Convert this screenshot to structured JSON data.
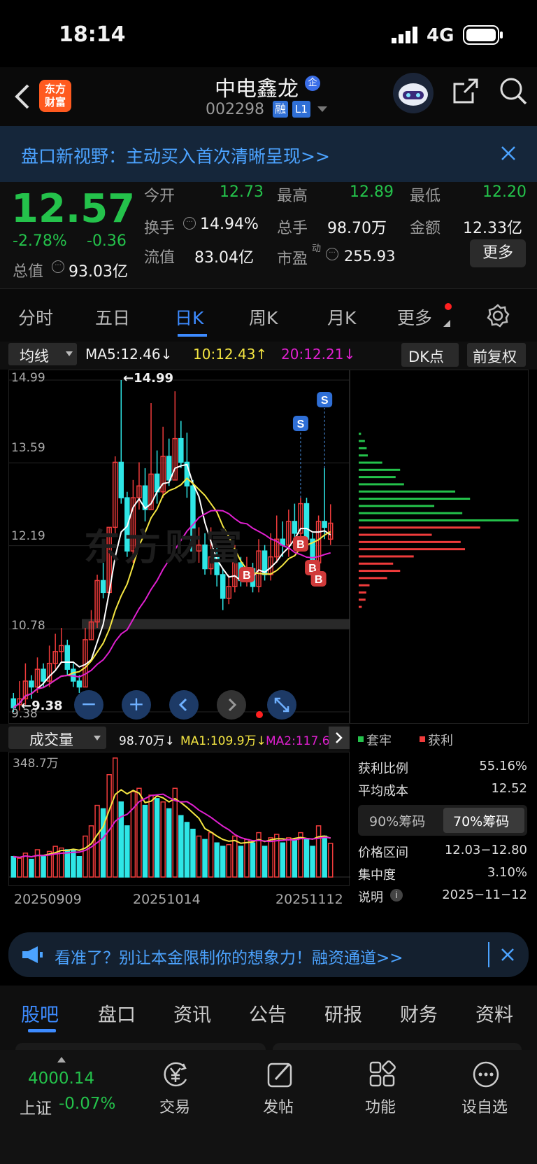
{
  "status_bar": {
    "time": "18:14",
    "network": "4G"
  },
  "header": {
    "broker_logo": "东方\n财富",
    "stock_name": "中电鑫龙",
    "badge": "企",
    "stock_code": "002298",
    "tag1": "融",
    "tag2": "L1"
  },
  "promo_top": {
    "text": "盘口新视野：主动买入首次清晰呈现>>"
  },
  "quote": {
    "price": "12.57",
    "change_pct": "-2.78%",
    "change_amt": "-0.36",
    "total_cap_label": "总值",
    "total_cap": "93.03亿",
    "open_label": "今开",
    "open": "12.73",
    "high_label": "最高",
    "high": "12.89",
    "low_label": "最低",
    "low": "12.20",
    "turnover_label": "换手",
    "turnover": "14.94%",
    "volume_label": "总手",
    "volume": "98.70万",
    "amount_label": "金额",
    "amount": "12.33亿",
    "float_label": "流值",
    "float_cap": "83.04亿",
    "pe_label": "市盈",
    "pe_sup": "动",
    "pe": "255.93",
    "more_button": "更多"
  },
  "period_tabs": [
    "分时",
    "五日",
    "日K",
    "周K",
    "月K",
    "更多"
  ],
  "active_tab": 2,
  "ma_bar": {
    "selector": "均线",
    "ma5": "MA5:12.46↓",
    "ma10": "10:12.43↑",
    "ma20": "20:12.21↓",
    "dk": "DK点",
    "adjust": "前复权"
  },
  "price_axis": [
    "14.99",
    "13.59",
    "12.19",
    "10.78",
    "9.38"
  ],
  "max_annotation": "←14.99",
  "min_annotation": "←9.38",
  "watermark": "东方财富",
  "vol_bar": {
    "selector": "成交量",
    "vol": "98.70万↓",
    "ma1": "MA1:109.9万↓",
    "ma2": "MA2:117.6万"
  },
  "vol_axis_max": "348.7万",
  "date_axis": [
    "20250909",
    "20251014",
    "20251112"
  ],
  "chips": {
    "legend_trapped": "套牢",
    "legend_profit": "获利",
    "profit_ratio_label": "获利比例",
    "profit_ratio": "55.16%",
    "avg_cost_label": "平均成本",
    "avg_cost": "12.52",
    "tab90": "90%筹码",
    "tab70": "70%筹码",
    "range_label": "价格区间",
    "range": "12.03−12.80",
    "concentration_label": "集中度",
    "concentration": "3.10%",
    "note_label": "说明",
    "date": "2025−11−12"
  },
  "promo_bottom": {
    "text": "看准了？别让本金限制你的想象力！融资通道>>"
  },
  "content_tabs": [
    "股吧",
    "盘口",
    "资讯",
    "公告",
    "研报",
    "财务",
    "资料"
  ],
  "bottom_nav": {
    "index_value": "4000.14",
    "index_name": "上证",
    "index_change": "-0.07%",
    "items": [
      "交易",
      "发帖",
      "功能",
      "设自选"
    ]
  },
  "colors": {
    "up": "#ef3b3b",
    "down": "#2ee6e6",
    "ma5": "#ffffff",
    "ma10": "#f5e642",
    "ma20": "#e020d0",
    "price_down": "#24c24b"
  },
  "chart_data": {
    "type": "candlestick",
    "title": "",
    "x_range": [
      "20250909",
      "20251112"
    ],
    "ylim": [
      9.38,
      14.99
    ],
    "candles": [
      {
        "o": 9.6,
        "c": 9.45,
        "h": 9.7,
        "l": 9.38
      },
      {
        "o": 9.5,
        "c": 9.6,
        "h": 9.9,
        "l": 9.4
      },
      {
        "o": 9.6,
        "c": 9.9,
        "h": 10.2,
        "l": 9.5
      },
      {
        "o": 9.9,
        "c": 9.8,
        "h": 10.0,
        "l": 9.6
      },
      {
        "o": 9.8,
        "c": 10.1,
        "h": 10.3,
        "l": 9.7
      },
      {
        "o": 10.1,
        "c": 9.9,
        "h": 10.2,
        "l": 9.8
      },
      {
        "o": 9.9,
        "c": 10.2,
        "h": 10.5,
        "l": 9.8
      },
      {
        "o": 10.2,
        "c": 10.4,
        "h": 10.7,
        "l": 10.1
      },
      {
        "o": 10.4,
        "c": 10.5,
        "h": 10.8,
        "l": 10.2
      },
      {
        "o": 10.5,
        "c": 10.1,
        "h": 10.6,
        "l": 10.0
      },
      {
        "o": 10.1,
        "c": 9.9,
        "h": 10.2,
        "l": 9.8
      },
      {
        "o": 9.9,
        "c": 9.8,
        "h": 10.0,
        "l": 9.7
      },
      {
        "o": 9.8,
        "c": 10.6,
        "h": 10.8,
        "l": 9.8
      },
      {
        "o": 10.6,
        "c": 10.9,
        "h": 11.1,
        "l": 10.6
      },
      {
        "o": 10.9,
        "c": 11.6,
        "h": 11.7,
        "l": 10.8
      },
      {
        "o": 11.6,
        "c": 11.4,
        "h": 11.9,
        "l": 11.3
      },
      {
        "o": 11.4,
        "c": 12.5,
        "h": 12.5,
        "l": 11.4
      },
      {
        "o": 12.5,
        "c": 13.6,
        "h": 13.7,
        "l": 12.4
      },
      {
        "o": 13.6,
        "c": 13.0,
        "h": 14.99,
        "l": 12.9
      },
      {
        "o": 13.0,
        "c": 12.1,
        "h": 13.1,
        "l": 12.0
      },
      {
        "o": 12.1,
        "c": 13.0,
        "h": 13.3,
        "l": 11.9
      },
      {
        "o": 13.0,
        "c": 13.2,
        "h": 13.6,
        "l": 12.8
      },
      {
        "o": 13.2,
        "c": 12.8,
        "h": 13.5,
        "l": 12.6
      },
      {
        "o": 12.8,
        "c": 13.4,
        "h": 14.6,
        "l": 12.8
      },
      {
        "o": 13.4,
        "c": 13.1,
        "h": 13.8,
        "l": 12.9
      },
      {
        "o": 13.1,
        "c": 13.7,
        "h": 14.2,
        "l": 13.0
      },
      {
        "o": 13.7,
        "c": 13.3,
        "h": 14.0,
        "l": 13.2
      },
      {
        "o": 13.3,
        "c": 14.0,
        "h": 14.8,
        "l": 13.3
      },
      {
        "o": 14.0,
        "c": 13.6,
        "h": 14.3,
        "l": 13.5
      },
      {
        "o": 13.6,
        "c": 13.2,
        "h": 14.1,
        "l": 13.0
      },
      {
        "o": 13.2,
        "c": 12.1,
        "h": 13.3,
        "l": 12.0
      },
      {
        "o": 12.1,
        "c": 12.2,
        "h": 12.5,
        "l": 11.9
      },
      {
        "o": 12.2,
        "c": 11.8,
        "h": 12.4,
        "l": 11.7
      },
      {
        "o": 11.8,
        "c": 12.0,
        "h": 12.5,
        "l": 11.7
      },
      {
        "o": 12.0,
        "c": 11.7,
        "h": 12.2,
        "l": 11.5
      },
      {
        "o": 11.7,
        "c": 11.3,
        "h": 11.8,
        "l": 11.1
      },
      {
        "o": 11.3,
        "c": 11.5,
        "h": 11.7,
        "l": 11.2
      },
      {
        "o": 11.5,
        "c": 11.9,
        "h": 12.2,
        "l": 11.4
      },
      {
        "o": 11.9,
        "c": 11.6,
        "h": 12.0,
        "l": 11.5
      },
      {
        "o": 11.6,
        "c": 11.8,
        "h": 12.0,
        "l": 11.5
      },
      {
        "o": 11.8,
        "c": 11.5,
        "h": 11.9,
        "l": 11.4
      },
      {
        "o": 11.5,
        "c": 12.1,
        "h": 12.3,
        "l": 11.4
      },
      {
        "o": 12.1,
        "c": 11.7,
        "h": 12.2,
        "l": 11.6
      },
      {
        "o": 11.7,
        "c": 12.0,
        "h": 12.4,
        "l": 11.6
      },
      {
        "o": 12.0,
        "c": 12.3,
        "h": 12.7,
        "l": 11.9
      },
      {
        "o": 12.3,
        "c": 12.2,
        "h": 12.6,
        "l": 12.0
      },
      {
        "o": 12.2,
        "c": 12.6,
        "h": 12.8,
        "l": 12.0
      },
      {
        "o": 12.6,
        "c": 12.4,
        "h": 12.9,
        "l": 12.2
      },
      {
        "o": 12.4,
        "c": 12.9,
        "h": 13.0,
        "l": 12.3
      },
      {
        "o": 12.9,
        "c": 12.3,
        "h": 13.0,
        "l": 12.2
      },
      {
        "o": 12.3,
        "c": 11.9,
        "h": 12.4,
        "l": 11.8
      },
      {
        "o": 11.9,
        "c": 12.6,
        "h": 12.7,
        "l": 11.8
      },
      {
        "o": 12.6,
        "c": 12.5,
        "h": 13.5,
        "l": 12.3
      },
      {
        "o": 12.3,
        "c": 12.57,
        "h": 12.89,
        "l": 12.2
      }
    ],
    "volumes": [
      60,
      55,
      70,
      52,
      80,
      60,
      75,
      90,
      85,
      80,
      78,
      60,
      120,
      150,
      210,
      200,
      300,
      348.7,
      220,
      150,
      250,
      260,
      210,
      240,
      230,
      220,
      200,
      260,
      180,
      160,
      140,
      120,
      110,
      130,
      100,
      90,
      95,
      120,
      90,
      110,
      100,
      130,
      90,
      115,
      125,
      100,
      115,
      110,
      130,
      110,
      90,
      150,
      120,
      98.7
    ]
  }
}
